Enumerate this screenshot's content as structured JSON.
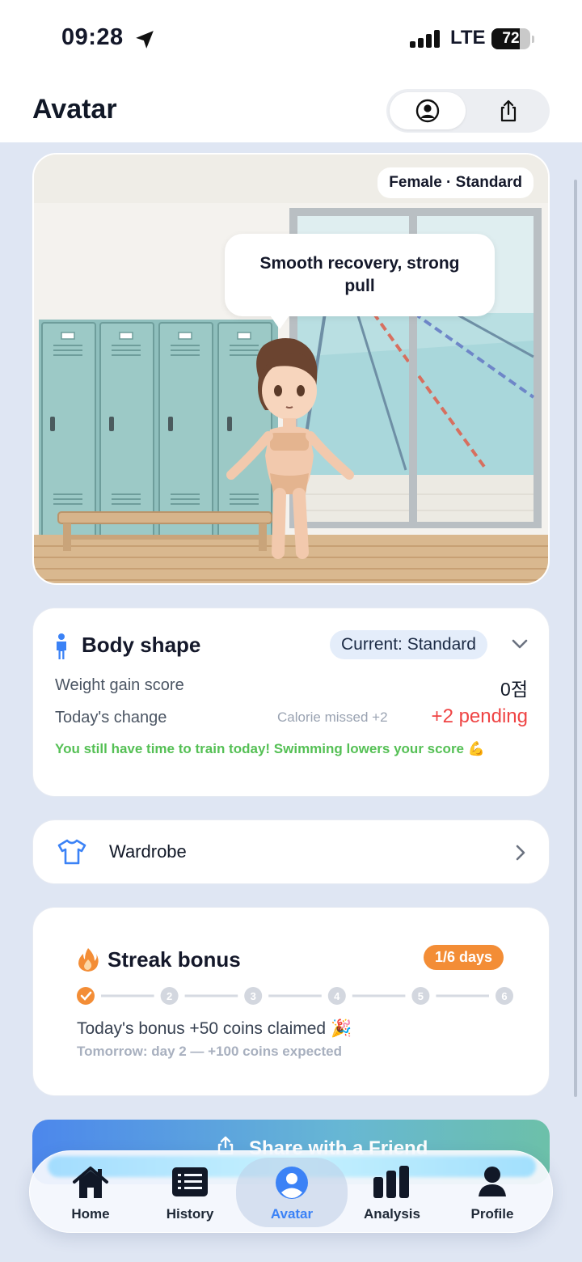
{
  "status_bar": {
    "time": "09:28",
    "network": "LTE",
    "battery": "72",
    "battery_level": 0.72
  },
  "header": {
    "title": "Avatar",
    "segment_icons": [
      "person-circle-icon",
      "share-icon"
    ]
  },
  "scene": {
    "chip": "Female · Standard",
    "speech": "Smooth recovery, strong pull"
  },
  "body_shape": {
    "title": "Body shape",
    "current": "Current: Standard",
    "weight_label": "Weight gain score",
    "weight_value": "0점",
    "change_label": "Today's change",
    "calorie_missed": "Calorie missed +2",
    "pending": "+2 pending",
    "encouragement": "You still have time to train today! Swimming lowers your score 💪"
  },
  "wardrobe": {
    "label": "Wardrobe"
  },
  "streak": {
    "title": "Streak bonus",
    "badge": "1/6 days",
    "steps": [
      "1",
      "2",
      "3",
      "4",
      "5",
      "6"
    ],
    "completed_steps": 1,
    "message": "Today's bonus +50 coins claimed 🎉",
    "sub": "Tomorrow: day 2 — +100 coins expected"
  },
  "share": {
    "label": "Share with a Friend"
  },
  "tabs": [
    {
      "label": "Home",
      "icon": "home-icon"
    },
    {
      "label": "History",
      "icon": "list-icon"
    },
    {
      "label": "Avatar",
      "icon": "avatar-icon",
      "active": true
    },
    {
      "label": "Analysis",
      "icon": "bar-chart-icon"
    },
    {
      "label": "Profile",
      "icon": "person-icon"
    }
  ],
  "colors": {
    "accent": "#3b82f6",
    "pending": "#ef4444",
    "encourage": "#55c055",
    "streak": "#f38d36"
  }
}
